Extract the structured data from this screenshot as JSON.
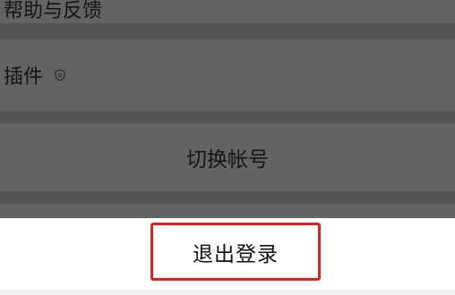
{
  "settings": {
    "items": [
      {
        "label": "帮助与反馈"
      },
      {
        "label": "插件",
        "icon": "shield-icon"
      }
    ],
    "switch_account_label": "切换帐号"
  },
  "action_sheet": {
    "logout_label": "退出登录",
    "highlight_color": "#e02020"
  }
}
